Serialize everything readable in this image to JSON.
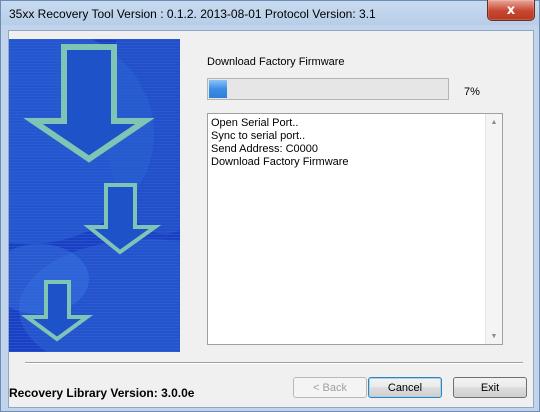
{
  "window": {
    "title": "35xx Recovery Tool Version : 0.1.2. 2013-08-01 Protocol Version: 3.1",
    "close_glyph": "x"
  },
  "status": {
    "step_label": "Download Factory Firmware",
    "progress_fraction": 0.07,
    "percent_text": "7%",
    "progress_color": "#3a8ee6"
  },
  "log": {
    "lines": [
      "Open Serial Port..",
      "Sync to serial port..",
      "Send Address: C0000",
      "Download Factory Firmware"
    ],
    "scroll_up_glyph": "▲",
    "scroll_down_glyph": "▼"
  },
  "footer": {
    "library_version": "Recovery Library Version: 3.0.0e"
  },
  "buttons": {
    "back_label": "< Back",
    "cancel_label": "Cancel",
    "exit_label": "Exit"
  },
  "banner": {
    "icon": "download-arrows-graphic",
    "background_color": "#1840c4",
    "arrow_color": "#7fc4b4"
  }
}
